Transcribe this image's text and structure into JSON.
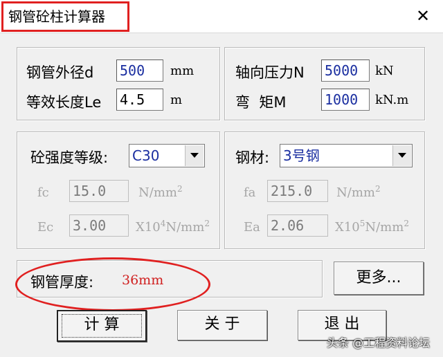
{
  "window": {
    "title": "钢管砼柱计算器",
    "close_label": "✕"
  },
  "geometry": {
    "diameter_label": "钢管外径d",
    "diameter_value": "500",
    "diameter_unit": "mm",
    "length_label": "等效长度Le",
    "length_value": "4.5",
    "length_unit": "m"
  },
  "loads": {
    "axial_label": "轴向压力N",
    "axial_value": "5000",
    "axial_unit": "kN",
    "moment_label": "弯  矩M",
    "moment_value": "1000",
    "moment_unit": "kN.m"
  },
  "concrete": {
    "grade_label": "砼强度等级:",
    "grade_value": "C30",
    "fc_label": "fc",
    "fc_value": "15.0",
    "fc_unit": "N/mm",
    "ec_label": "Ec",
    "ec_value": "3.00",
    "ec_unit_base": "X10",
    "ec_unit_exp": "4",
    "ec_unit_rest": "N/mm"
  },
  "steel": {
    "material_label": "钢材:",
    "material_value": "3号钢",
    "fa_label": "fa",
    "fa_value": "215.0",
    "fa_unit": "N/mm",
    "ea_label": "Ea",
    "ea_value": "2.06",
    "ea_unit_base": "X10",
    "ea_unit_exp": "5",
    "ea_unit_rest": "N/mm"
  },
  "unit_squared": "2",
  "result": {
    "label": "钢管厚度:",
    "value": "36mm",
    "value_color": "#d02020"
  },
  "buttons": {
    "more": "更多...",
    "calculate": "计 算",
    "about": "关 于",
    "exit": "退 出"
  },
  "watermark": "头条 @工程资料论坛",
  "colors": {
    "highlight": "#e02020",
    "input_text": "#1a2ea0"
  }
}
